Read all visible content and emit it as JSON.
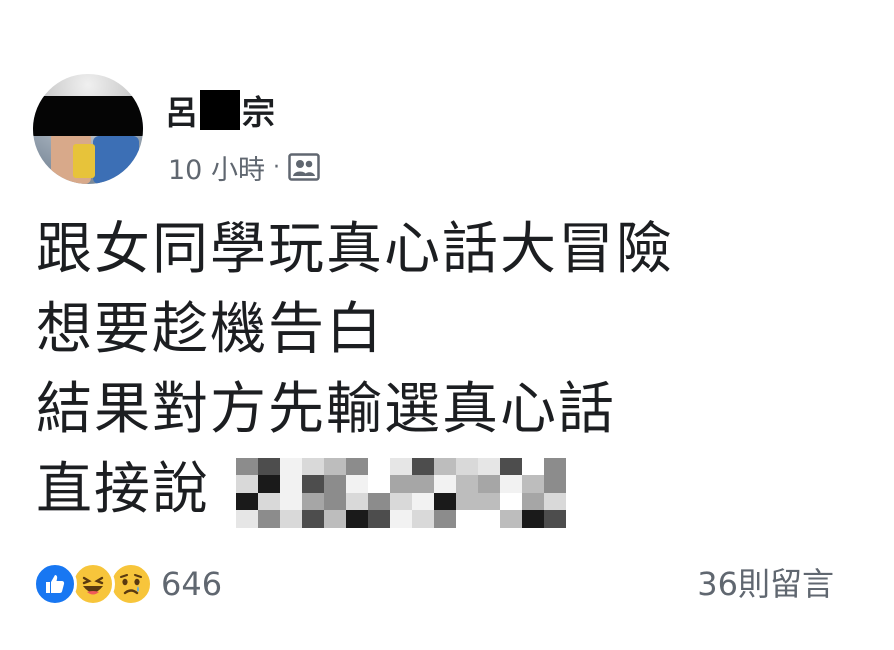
{
  "post": {
    "author": {
      "name_first": "呂",
      "name_last": "宗"
    },
    "timestamp": "10 小時",
    "separator": "·",
    "audience_icon": "group-icon",
    "lines": [
      "跟女同學玩真心話大冒險",
      "想要趁機告白",
      "結果對方先輸選真心話",
      "直接說"
    ]
  },
  "footer": {
    "reaction_icons": [
      "like-icon",
      "haha-icon",
      "sad-icon"
    ],
    "reaction_count": "646",
    "comments": "36則留言"
  },
  "colors": {
    "text": "#1c1e21",
    "meta": "#606770",
    "like": "#1877f2",
    "emoji": "#f7c53b"
  }
}
